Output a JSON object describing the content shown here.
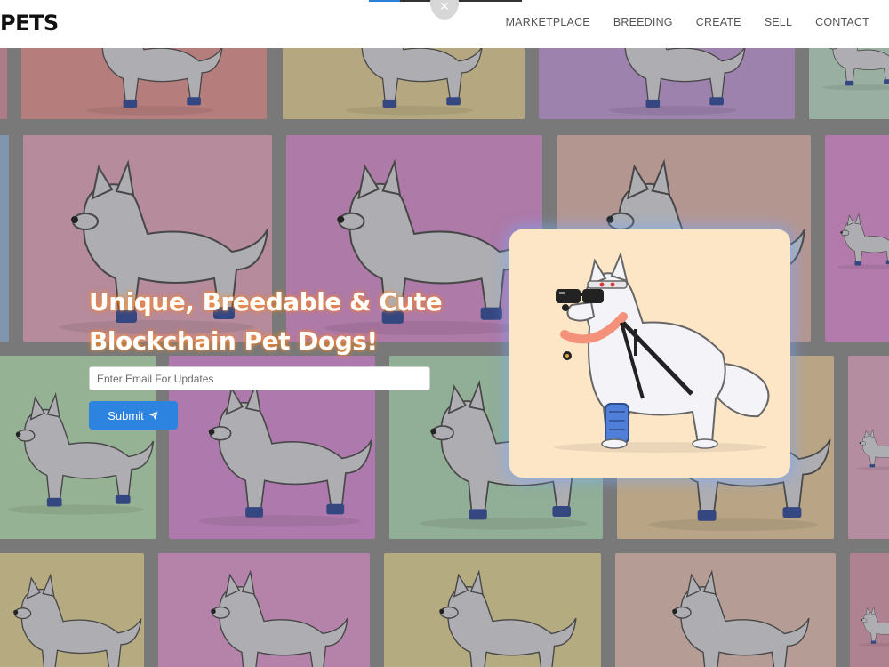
{
  "brand": {
    "logo_text": "PETS"
  },
  "nav": {
    "items": [
      "MARKETPLACE",
      "BREEDING",
      "CREATE",
      "SELL",
      "CONTACT"
    ]
  },
  "modal": {
    "close_symbol": "×"
  },
  "hero": {
    "title_line1": "Unique, Breedable & Cute",
    "title_line2": "Blockchain Pet Dogs!",
    "email_placeholder": "Enter Email For Updates",
    "submit_label": "Submit"
  },
  "icons": {
    "submit": "paper-plane-icon",
    "close": "close-icon"
  },
  "colors": {
    "accent": "#2c83e0",
    "card_bg": "#fde6c6",
    "title_glow": "#ff8c28"
  }
}
